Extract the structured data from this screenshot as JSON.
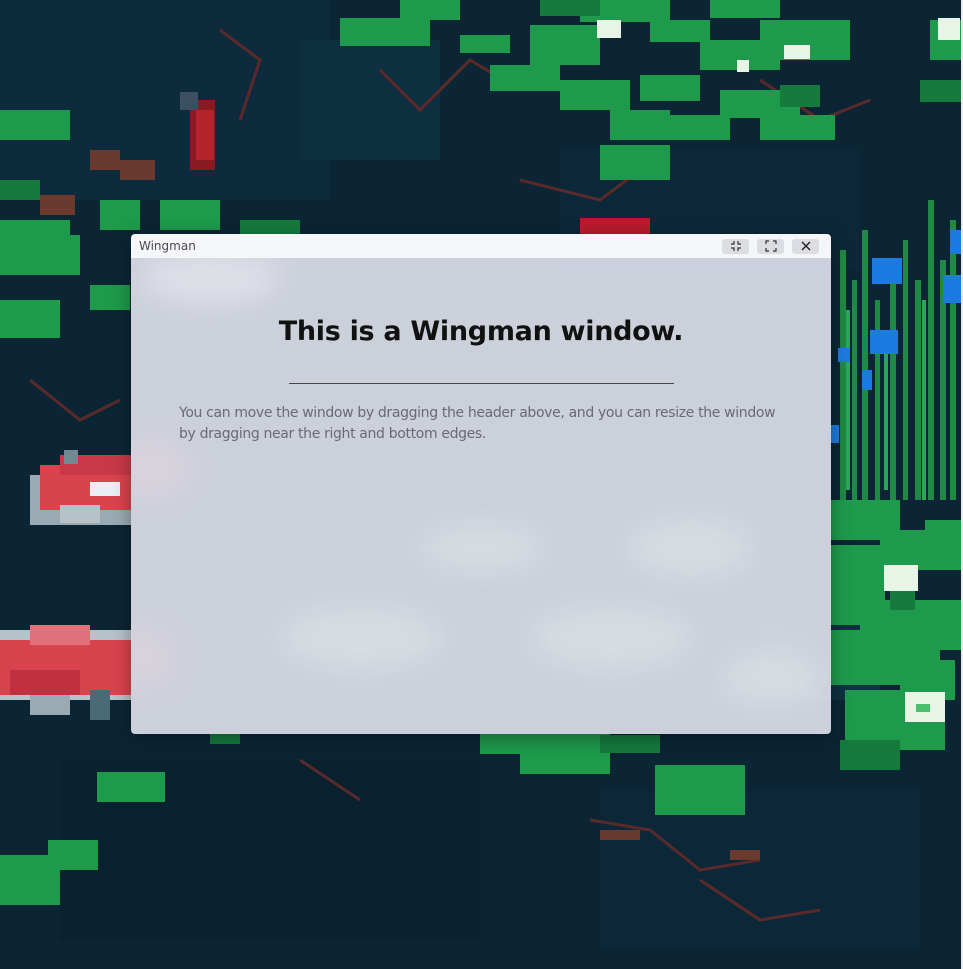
{
  "window": {
    "title": "Wingman",
    "heading": "This is a Wingman window.",
    "description": "You can move the window by dragging the header above, and you can resize the window by dragging near the right and bottom edges.",
    "controls": {
      "minimize_icon": "collapse-icon",
      "maximize_icon": "expand-icon",
      "close_icon": "close-icon"
    }
  },
  "wallpaper": {
    "theme": "pixel-art koi pond",
    "colors": {
      "water": "#0a2433",
      "lily_pad": "#1e9a4c",
      "koi": "#d9434e"
    }
  }
}
